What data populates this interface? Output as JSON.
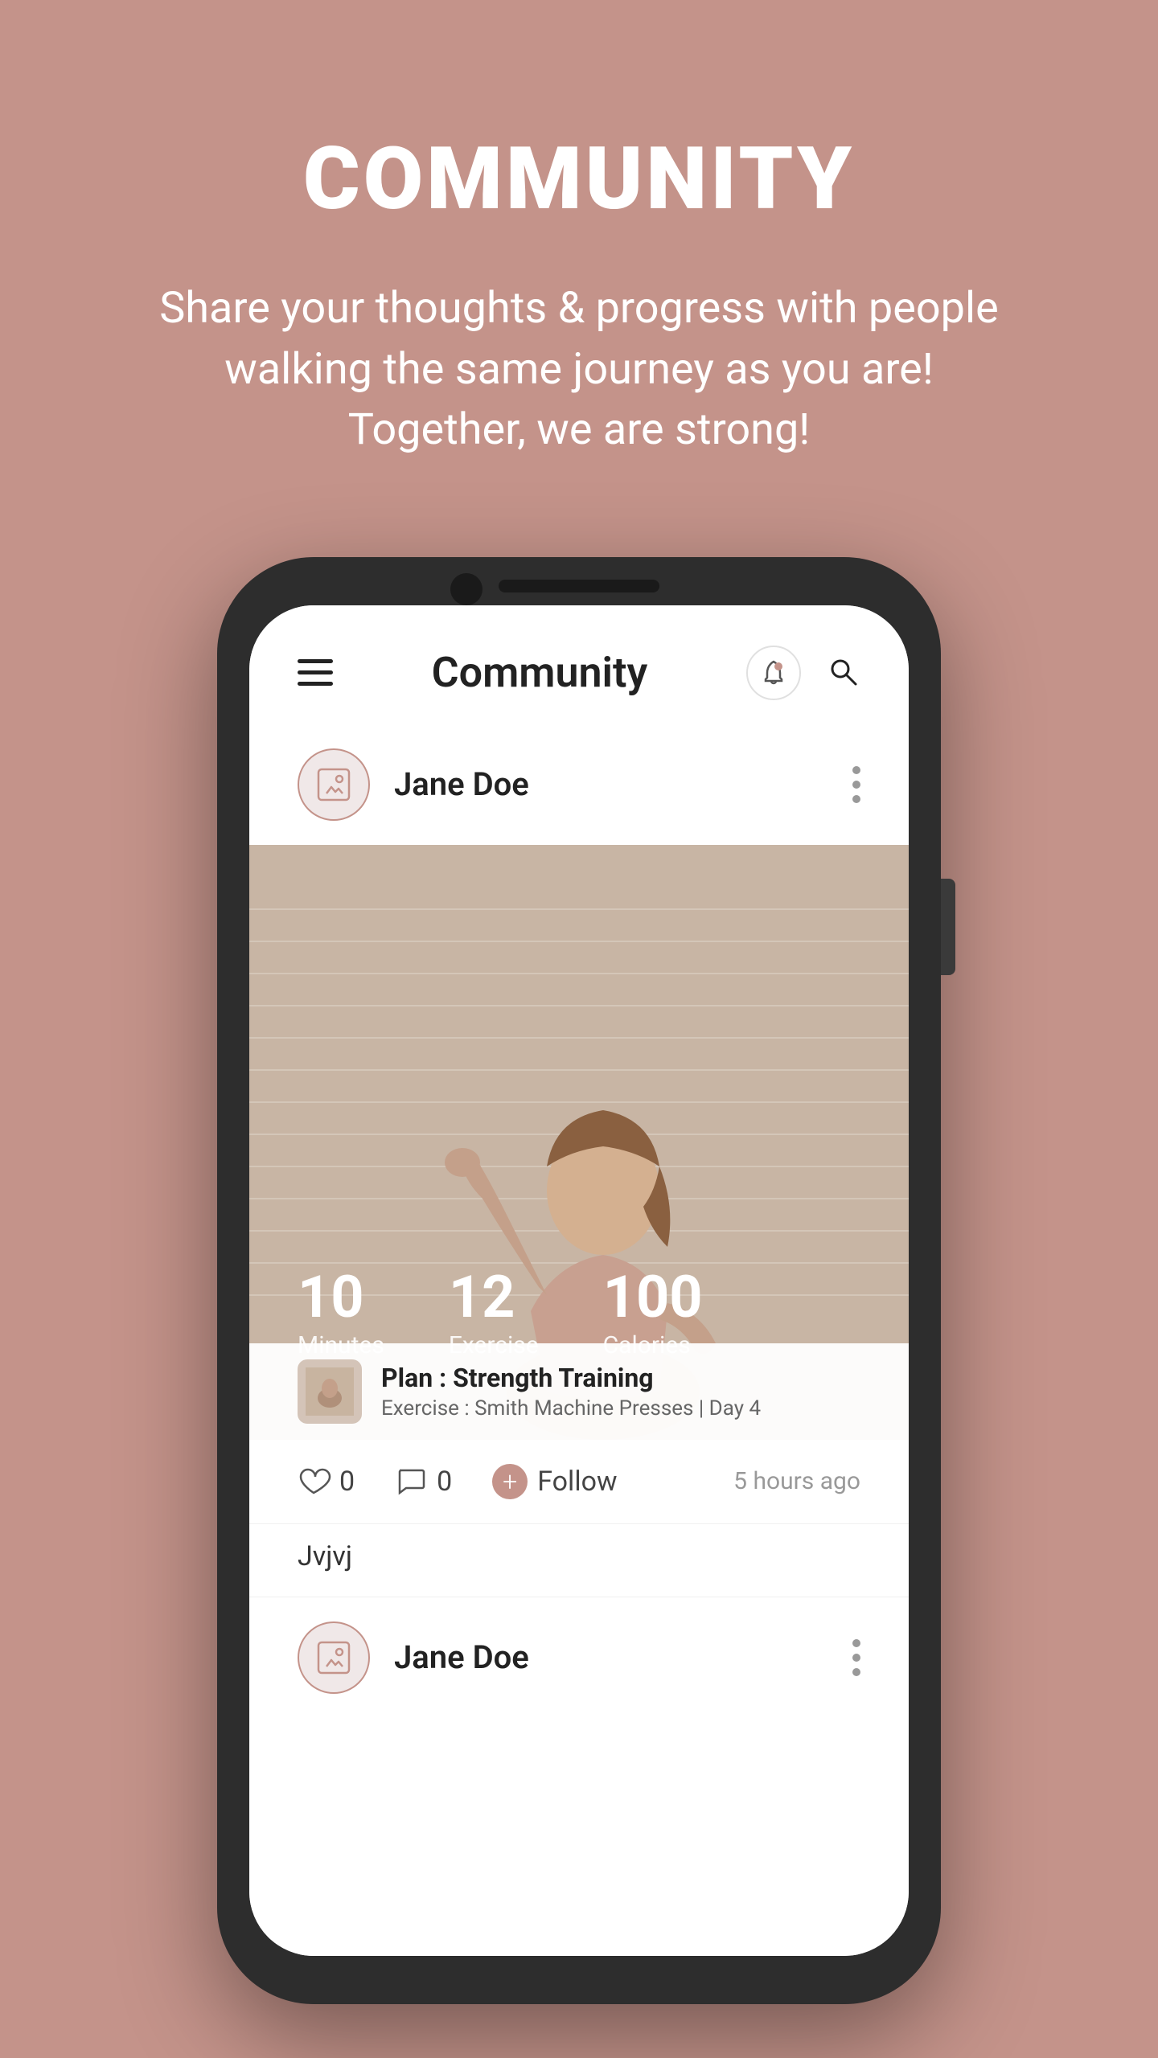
{
  "page": {
    "title": "COMMUNITY",
    "subtitle": "Share your thoughts & progress with people walking the same journey as you are! Together, we are strong!"
  },
  "colors": {
    "background": "#c4938a",
    "accent": "#9b3a5a",
    "phone_bg": "#2d2d2d",
    "screen_bg": "#ffffff"
  },
  "app": {
    "header_title": "Community",
    "hamburger_label": "menu",
    "notification_label": "notifications",
    "search_label": "search"
  },
  "post": {
    "user_name": "Jane Doe",
    "stats": [
      {
        "number": "10",
        "label": "Minutes"
      },
      {
        "number": "12",
        "label": "Exercise"
      },
      {
        "number": "100",
        "label": "Calories"
      }
    ],
    "plan_title": "Plan : Strength Training",
    "plan_subtitle": "Exercise : Smith Machine Presses | Day 4",
    "likes_count": "0",
    "comments_count": "0",
    "follow_label": "Follow",
    "time_ago": "5 hours ago",
    "caption": "Jvjvj"
  },
  "second_post": {
    "user_name": "Jane Doe"
  }
}
